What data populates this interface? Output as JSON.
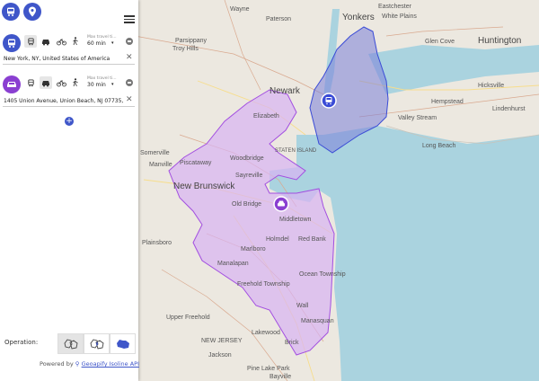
{
  "map": {
    "labels": {
      "paterson": "Paterson",
      "yonkers": "Yonkers",
      "wayne": "Wayne",
      "eastchester": "Eastchester",
      "white_plains": "White Plains",
      "huntington": "Huntington",
      "glen_cove": "Glen Cove",
      "newark": "Newark",
      "elizabeth": "Elizabeth",
      "hempstead": "Hempstead",
      "valley_stream": "Valley Stream",
      "long_beach": "Long Beach",
      "new_brunswick": "New Brunswick",
      "woodbridge": "Woodbridge",
      "middletown": "Middletown",
      "red_bank": "Red Bank",
      "holmdel": "Holmdel",
      "marlboro": "Marlboro",
      "manalapan": "Manalapan",
      "freehold": "Freehold Township",
      "wall": "Wall",
      "lakewood": "Lakewood",
      "brick": "Brick",
      "jersey": "NEW JERSEY",
      "parsippany": "Parsippany",
      "piscataway": "Piscataway",
      "somerville": "Somerville",
      "manville": "Manville",
      "plainsboro": "Plainsboro",
      "upper_freehold": "Upper Freehold",
      "ocean": "Ocean Township",
      "manasquan": "Manasquan",
      "staten": "STATEN ISLAND",
      "lindenhurst": "Lindenhurst",
      "hicksville": "Hicksville",
      "troy_hills": "Troy Hills",
      "sayreville": "Sayreville",
      "old_bridge": "Old Bridge",
      "pine_lake_park": "Pine Lake Park",
      "jackson": "Jackson",
      "bayville": "Bayville"
    }
  },
  "panel": {
    "rows": [
      {
        "travel_label": "Max travel ti...",
        "travel_value": "60 min",
        "address": "New York, NY, United States of America"
      },
      {
        "travel_label": "Max travel ti...",
        "travel_value": "30 min",
        "address": "1405 Union Avenue, Union Beach, NJ 07735, Uni"
      }
    ],
    "add_symbol": "+",
    "operation_label": "Operation:",
    "powered_prefix": "Powered by",
    "powered_link": "Geoapify Isoline API",
    "clear_symbol": "✕"
  },
  "colors": {
    "iso1_fill": "#7b7fd8",
    "iso1_stroke": "#3a4bd6",
    "iso2_fill": "#d9b4f2",
    "iso2_stroke": "#a24ee0",
    "accent_blue": "#3f56c9",
    "accent_purple": "#8a3fd1"
  }
}
